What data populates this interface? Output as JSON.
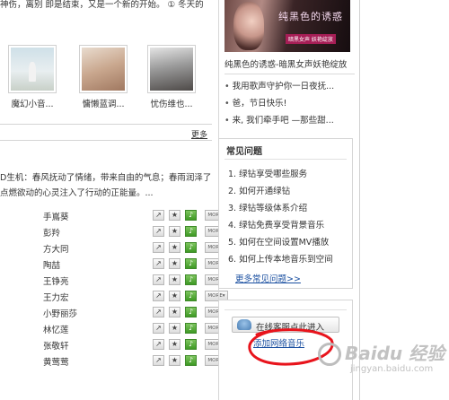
{
  "intro_text": "神伤，离别 即是结束，又是一个新的开始。 ① 冬天的",
  "albums": [
    {
      "caption": "魔幻小音..."
    },
    {
      "caption": "慵懒蓝调..."
    },
    {
      "caption": "忧伤维也..."
    }
  ],
  "albums_more": "更多",
  "description": "D生机：春风抚动了情绪，带来自由的气息；春雨润泽了 点燃欲动的心灵注入了行动的正能量。...",
  "singers": [
    {
      "name": "手嶌葵"
    },
    {
      "name": "彭羚"
    },
    {
      "name": "方大同"
    },
    {
      "name": "陶喆"
    },
    {
      "name": "王铮亮"
    },
    {
      "name": "王力宏"
    },
    {
      "name": "小野丽莎"
    },
    {
      "name": "林忆莲"
    },
    {
      "name": "张敬轩"
    },
    {
      "name": "黄莺莺"
    }
  ],
  "singer_more_label": "MORE▾",
  "banner": {
    "title_art": "纯黑色的诱惑",
    "tag": "暗黑女声 妖艳绽放",
    "caption": "纯黑色的诱惑-暗黑女声妖艳绽放"
  },
  "featured_list": [
    "我用歌声守护你一日夜抚...",
    "爸，节日快乐!",
    "来, 我们牵手吧 —那些甜..."
  ],
  "faq": {
    "title": "常见问题",
    "items": [
      "1. 绿钻享受哪些服务",
      "2. 如何开通绿钻",
      "3. 绿钻等级体系介绍",
      "4. 绿钻免费享受背景音乐",
      "5. 如何在空间设置MV播放",
      "6. 如何上传本地音乐到空间"
    ],
    "more": "更多常见问题>>"
  },
  "enter_button": "在线客服点此进入",
  "add_network_music": "添加网络音乐",
  "watermark": {
    "brand": "Baidu 经验",
    "url": "jingyan.baidu.com"
  },
  "colors": {
    "link": "#1a4fa0",
    "green_button": "#3f9a25",
    "annotation_red": "#e8141c"
  }
}
